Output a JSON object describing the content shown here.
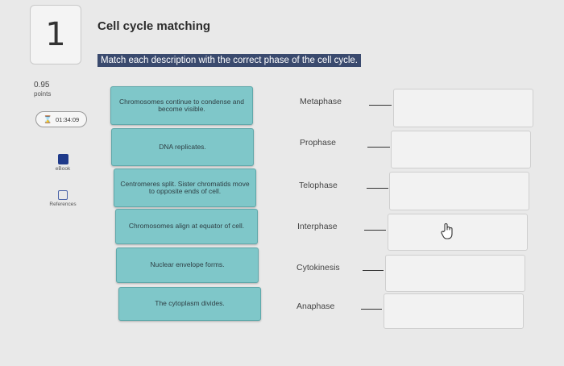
{
  "question": {
    "number": "1",
    "title": "Cell cycle matching",
    "instruction": "Match each description with the correct phase of the cell cycle."
  },
  "sidebar": {
    "score": "0.95",
    "score_unit": "points",
    "timer": "01:34:09",
    "ebook_label": "eBook",
    "references_label": "References"
  },
  "descriptions": [
    "Chromosomes continue to condense and become visible.",
    "DNA replicates.",
    "Centromeres split. Sister chromatids move to opposite ends of cell.",
    "Chromosomes align at equator of cell.",
    "Nuclear envelope forms.",
    "The cytoplasm divides."
  ],
  "phases": [
    "Metaphase",
    "Prophase",
    "Telophase",
    "Interphase",
    "Cytokinesis",
    "Anaphase"
  ],
  "colors": {
    "card_fill": "#7fc7c9",
    "instruction_highlight": "#3a4a6e"
  },
  "icons": {
    "timer": "hourglass-icon",
    "ebook": "book-icon",
    "references": "references-icon",
    "cursor": "hand-cursor-icon"
  }
}
